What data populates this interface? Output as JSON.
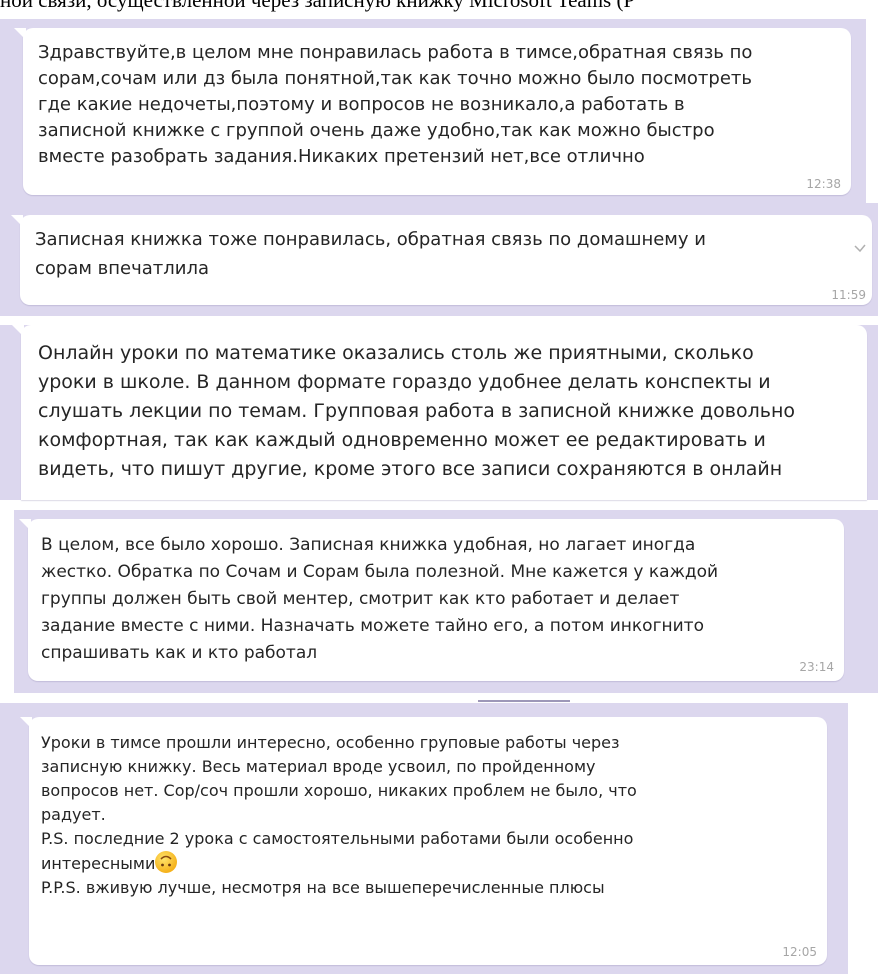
{
  "caption": "ной связи, осуществленной через записную книжку Microsoft Teams (Р",
  "messages": [
    {
      "text": "Здравствуйте,в целом мне понравилась работа в тимсе,обратная связь по\nсорам,сочам или дз была понятной,так как точно можно было посмотреть\nгде какие недочеты,поэтому и вопросов не возникало,а работать в\nзаписной книжке с группой очень даже удобно,так как можно быстро\nвместе разобрать задания.Никаких претензий нет,все отлично",
      "time": "12:38"
    },
    {
      "text": "Записная книжка тоже понравилась, обратная связь по домашнему и\nсорам впечатлила",
      "time": "11:59"
    },
    {
      "text": "Онлайн уроки по математике оказались столь же приятными, сколько\nуроки в школе. В данном формате гораздо удобнее делать конспекты и\nслушать лекции по темам. Групповая работа в записной книжке довольно\nкомфортная, так как каждый одновременно может ее редактировать и\nвидеть, что пишут другие, кроме этого все записи сохраняются в онлайн",
      "time": ""
    },
    {
      "text": "В целом, все было хорошо. Записная книжка удобная, но лагает иногда\nжестко. Обратка по Сочам и Сорам была полезной. Мне кажется у каждой\nгруппы должен быть свой ментер, смотрит как кто работает и делает\nзадание вместе с ними. Назначать можете тайно его, а потом инкогнито\nспрашивать как и кто работал",
      "time": "23:14"
    },
    {
      "text_before_emoji": "Уроки в тимсе прошли интересно, особенно груповые работы через\nзаписную книжку. Весь материал вроде усвоил, по пройденному\nвопросов нет. Сор/соч прошли хорошо, никаких проблем не было, что\nрадует.\nP.S. последние 2 урока с самостоятельными работами были особенно\nинтересными",
      "text_after_emoji": "\nP.P.S. вживую лучше, несмотря на все вышеперечисленные плюсы",
      "emoji": "upside-down-face",
      "time": "12:05"
    }
  ],
  "colors": {
    "panel_bg": "#dcd7ee",
    "bubble_bg": "#ffffff",
    "text": "#252525",
    "time": "#a6a6a6"
  }
}
